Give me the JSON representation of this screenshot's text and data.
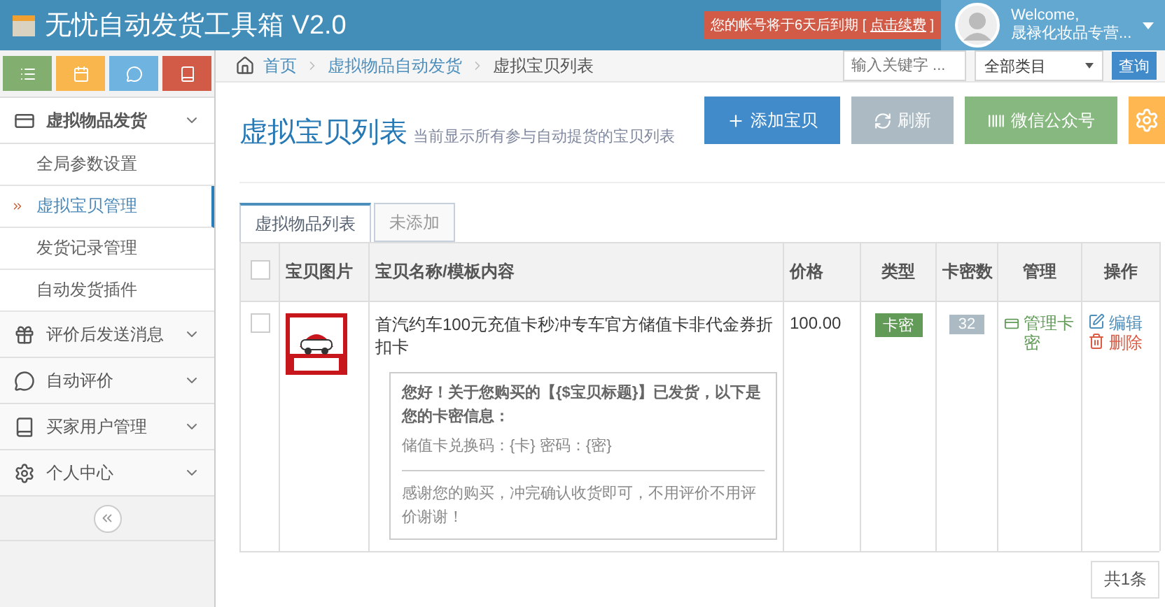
{
  "header": {
    "title": "无忧自动发货工具箱 V2.0",
    "notice": "您的帐号将于6天后到期",
    "bracket_open": "[",
    "notice_link": "点击续费",
    "bracket_close": "]",
    "welcome": "Welcome,",
    "user_name": "晟禄化妆品专营..."
  },
  "shortcuts": [
    {
      "kind": "list",
      "color": "#82af6f"
    },
    {
      "kind": "calendar",
      "color": "#f8b64c"
    },
    {
      "kind": "chat",
      "color": "#6fb3e0"
    },
    {
      "kind": "book",
      "color": "#d15b47"
    }
  ],
  "sidebar": [
    {
      "kind": "card",
      "label": "虚拟物品发货",
      "expanded": true,
      "children": [
        {
          "label": "全局参数设置",
          "selected": false
        },
        {
          "label": "虚拟宝贝管理",
          "selected": true
        },
        {
          "label": "发货记录管理",
          "selected": false
        },
        {
          "label": "自动发货插件",
          "selected": false
        }
      ]
    },
    {
      "kind": "gift",
      "label": "评价后发送消息",
      "expanded": false
    },
    {
      "kind": "chat",
      "label": "自动评价",
      "expanded": false
    },
    {
      "kind": "book",
      "label": "买家用户管理",
      "expanded": false
    },
    {
      "kind": "gear",
      "label": "个人中心",
      "expanded": false
    }
  ],
  "breadcrumb": [
    "首页",
    "虚拟物品自动发货",
    "虚拟宝贝列表"
  ],
  "search": {
    "placeholder": "输入关键字 ...",
    "category": "全部类目",
    "button": "查询"
  },
  "page_title": "虚拟宝贝列表",
  "page_subtitle": "当前显示所有参与自动提货的宝贝列表",
  "actions": [
    {
      "kind": "add",
      "label": "添加宝贝",
      "color": "#428bca"
    },
    {
      "kind": "refresh",
      "label": "刷新",
      "color": "#abbac3"
    },
    {
      "kind": "barcode",
      "label": "微信公众号",
      "color": "#87b87f"
    },
    {
      "kind": "gear",
      "color": "#ffb752"
    }
  ],
  "tabs": [
    {
      "label": "虚拟物品列表",
      "selected": true
    },
    {
      "label": "未添加",
      "selected": false
    }
  ],
  "table": {
    "all_checked": false,
    "columns": [
      "宝贝图片",
      "宝贝名称/模板内容",
      "价格",
      "类型",
      "卡密数",
      "管理",
      "操作"
    ],
    "rows": [
      {
        "checked": false,
        "name": "首汽约车100元充值卡秒冲专车官方储值卡非代金券折扣卡",
        "template": {
          "greeting": "您好！关于您购买的【{$宝贝标题}】已发货，以下是您的卡密信息：",
          "card_line": "储值卡兑换码：{卡} 密码：{密}",
          "footer": "感谢您的购买，冲完确认收货即可，不用评价不用评价谢谢！"
        },
        "price": "100.00",
        "type": "卡密",
        "count": "32",
        "manage": "管理卡密",
        "edit": "编辑",
        "delete": "删除"
      }
    ]
  },
  "total": "共1条"
}
